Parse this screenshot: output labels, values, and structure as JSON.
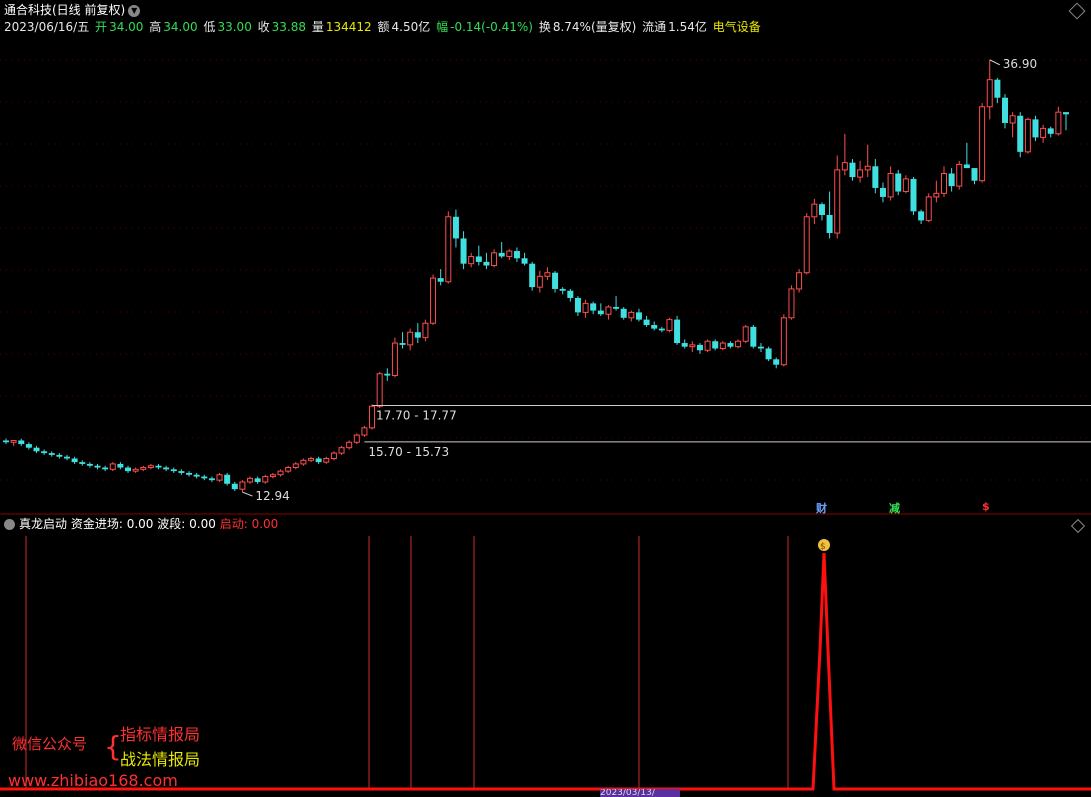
{
  "header": {
    "title": "通合科技(日线 前复权)",
    "date": "2023/06/16/五",
    "open_label": "开",
    "open": "34.00",
    "high_label": "高",
    "high": "34.00",
    "low_label": "低",
    "low": "33.00",
    "close_label": "收",
    "close": "33.88",
    "vol_label": "量",
    "vol": "134412",
    "amount_label": "额",
    "amount": "4.50亿",
    "change_label": "幅",
    "change": "-0.14(-0.41%)",
    "turnover_label": "换",
    "turnover": "8.74%(量复权)",
    "float_label": "流通",
    "float": "1.54亿",
    "sector": "电气设备"
  },
  "annotations": {
    "high_mark": "36.90",
    "low_mark": "12.94",
    "upper_line_label": "17.70 - 17.77",
    "lower_line_label": "15.70 - 15.73"
  },
  "badges": {
    "cai": "财",
    "jian": "减",
    "dollar": "$"
  },
  "indicator": {
    "name": "真龙启动",
    "fund_label": "资金进场:",
    "fund_value": "0.00",
    "wave_label": "波段:",
    "wave_value": "0.00",
    "start_label": "启动:",
    "start_value": "0.00"
  },
  "watermark": {
    "wechat": "微信公众号",
    "item1": "指标情报局",
    "item2": "战法情报局",
    "site": "www.zhibiao168.com"
  },
  "bottom_date": "2023/03/13/",
  "colors": {
    "up": "#ff4d4d",
    "down": "#40e0e0",
    "bg": "#000000",
    "grid": "#5a0000"
  },
  "chart_data": {
    "type": "candlestick",
    "y_range": [
      12.5,
      38
    ],
    "horizontal_lines": [
      17.74,
      15.72
    ],
    "candles": [
      [
        15.8,
        15.9,
        15.6,
        15.7
      ],
      [
        15.7,
        15.8,
        15.5,
        15.8
      ],
      [
        15.8,
        15.9,
        15.5,
        15.6
      ],
      [
        15.6,
        15.7,
        15.3,
        15.4
      ],
      [
        15.4,
        15.5,
        15.1,
        15.2
      ],
      [
        15.2,
        15.3,
        15.0,
        15.1
      ],
      [
        15.1,
        15.2,
        14.9,
        15.0
      ],
      [
        15.0,
        15.1,
        14.8,
        14.9
      ],
      [
        14.9,
        15.0,
        14.7,
        14.8
      ],
      [
        14.8,
        14.9,
        14.5,
        14.6
      ],
      [
        14.6,
        14.7,
        14.4,
        14.5
      ],
      [
        14.5,
        14.6,
        14.3,
        14.4
      ],
      [
        14.4,
        14.5,
        14.2,
        14.3
      ],
      [
        14.3,
        14.4,
        14.1,
        14.2
      ],
      [
        14.2,
        14.6,
        14.1,
        14.5
      ],
      [
        14.5,
        14.6,
        14.2,
        14.3
      ],
      [
        14.3,
        14.4,
        14.0,
        14.1
      ],
      [
        14.1,
        14.3,
        14.0,
        14.2
      ],
      [
        14.2,
        14.4,
        14.1,
        14.3
      ],
      [
        14.3,
        14.5,
        14.2,
        14.4
      ],
      [
        14.4,
        14.5,
        14.2,
        14.3
      ],
      [
        14.3,
        14.4,
        14.1,
        14.2
      ],
      [
        14.2,
        14.3,
        14.0,
        14.1
      ],
      [
        14.1,
        14.2,
        13.9,
        14.0
      ],
      [
        14.0,
        14.1,
        13.8,
        13.9
      ],
      [
        13.9,
        14.0,
        13.7,
        13.8
      ],
      [
        13.8,
        13.9,
        13.6,
        13.7
      ],
      [
        13.7,
        13.8,
        13.5,
        13.6
      ],
      [
        13.6,
        14.0,
        13.5,
        13.9
      ],
      [
        13.9,
        14.0,
        13.3,
        13.4
      ],
      [
        13.4,
        13.5,
        13.0,
        13.1
      ],
      [
        13.1,
        13.6,
        12.94,
        13.5
      ],
      [
        13.5,
        13.8,
        13.4,
        13.7
      ],
      [
        13.7,
        13.8,
        13.4,
        13.5
      ],
      [
        13.5,
        13.9,
        13.4,
        13.8
      ],
      [
        13.8,
        14.0,
        13.7,
        13.9
      ],
      [
        13.9,
        14.2,
        13.8,
        14.1
      ],
      [
        14.1,
        14.4,
        14.0,
        14.3
      ],
      [
        14.3,
        14.6,
        14.2,
        14.5
      ],
      [
        14.5,
        14.8,
        14.4,
        14.7
      ],
      [
        14.7,
        14.9,
        14.6,
        14.8
      ],
      [
        14.8,
        14.9,
        14.5,
        14.6
      ],
      [
        14.6,
        14.9,
        14.5,
        14.8
      ],
      [
        14.8,
        15.2,
        14.7,
        15.1
      ],
      [
        15.1,
        15.5,
        15.0,
        15.4
      ],
      [
        15.4,
        15.8,
        15.3,
        15.7
      ],
      [
        15.7,
        16.2,
        15.6,
        16.1
      ],
      [
        16.1,
        16.6,
        16.0,
        16.5
      ],
      [
        16.5,
        17.8,
        16.4,
        17.7
      ],
      [
        17.7,
        19.6,
        17.6,
        19.5
      ],
      [
        19.5,
        19.8,
        19.1,
        19.4
      ],
      [
        19.4,
        21.5,
        19.3,
        21.2
      ],
      [
        21.2,
        21.8,
        20.9,
        21.1
      ],
      [
        21.1,
        22.0,
        20.8,
        21.8
      ],
      [
        21.8,
        22.3,
        21.2,
        21.5
      ],
      [
        21.5,
        22.5,
        21.3,
        22.3
      ],
      [
        22.3,
        25.0,
        22.2,
        24.8
      ],
      [
        24.8,
        25.3,
        24.4,
        24.6
      ],
      [
        24.6,
        28.5,
        24.5,
        28.2
      ],
      [
        28.2,
        28.6,
        26.5,
        27.0
      ],
      [
        27.0,
        27.4,
        25.3,
        25.6
      ],
      [
        25.6,
        26.2,
        25.4,
        26.0
      ],
      [
        26.0,
        26.6,
        25.5,
        25.7
      ],
      [
        25.7,
        26.2,
        25.3,
        25.5
      ],
      [
        25.5,
        26.4,
        25.4,
        26.2
      ],
      [
        26.2,
        26.8,
        25.9,
        26.0
      ],
      [
        26.0,
        26.4,
        25.8,
        26.3
      ],
      [
        26.3,
        26.5,
        25.7,
        25.9
      ],
      [
        25.9,
        26.2,
        25.5,
        25.6
      ],
      [
        25.6,
        25.7,
        24.1,
        24.3
      ],
      [
        24.3,
        25.2,
        24.0,
        24.9
      ],
      [
        24.9,
        25.4,
        24.7,
        25.1
      ],
      [
        25.1,
        25.2,
        24.0,
        24.2
      ],
      [
        24.2,
        24.3,
        23.9,
        24.1
      ],
      [
        24.1,
        24.2,
        23.5,
        23.7
      ],
      [
        23.7,
        23.8,
        22.7,
        22.9
      ],
      [
        22.9,
        23.6,
        22.6,
        23.4
      ],
      [
        23.4,
        23.5,
        22.8,
        23.0
      ],
      [
        23.0,
        23.4,
        22.7,
        22.8
      ],
      [
        22.8,
        23.3,
        22.5,
        23.2
      ],
      [
        23.2,
        23.8,
        23.0,
        23.1
      ],
      [
        23.1,
        23.2,
        22.5,
        22.6
      ],
      [
        22.6,
        23.0,
        22.4,
        22.9
      ],
      [
        22.9,
        23.1,
        22.4,
        22.5
      ],
      [
        22.5,
        22.7,
        22.1,
        22.2
      ],
      [
        22.2,
        22.4,
        21.9,
        22.0
      ],
      [
        22.0,
        22.1,
        21.8,
        21.9
      ],
      [
        21.9,
        22.6,
        21.8,
        22.5
      ],
      [
        22.5,
        22.7,
        21.1,
        21.2
      ],
      [
        21.2,
        21.4,
        20.9,
        21.0
      ],
      [
        21.0,
        21.3,
        20.7,
        21.1
      ],
      [
        21.1,
        21.2,
        20.6,
        20.8
      ],
      [
        20.8,
        21.4,
        20.7,
        21.3
      ],
      [
        21.3,
        21.4,
        20.8,
        20.9
      ],
      [
        20.9,
        21.3,
        20.8,
        21.2
      ],
      [
        21.2,
        21.3,
        20.9,
        21.0
      ],
      [
        21.0,
        21.4,
        20.9,
        21.3
      ],
      [
        21.3,
        22.2,
        21.2,
        22.1
      ],
      [
        22.1,
        22.2,
        20.9,
        21.0
      ],
      [
        21.0,
        21.2,
        20.7,
        20.9
      ],
      [
        20.9,
        21.0,
        20.2,
        20.3
      ],
      [
        20.3,
        20.4,
        19.8,
        20.0
      ],
      [
        20.0,
        22.8,
        19.9,
        22.6
      ],
      [
        22.6,
        24.4,
        22.5,
        24.2
      ],
      [
        24.2,
        25.3,
        24.0,
        25.1
      ],
      [
        25.1,
        28.4,
        25.0,
        28.2
      ],
      [
        28.2,
        29.2,
        27.8,
        28.9
      ],
      [
        28.9,
        29.0,
        28.0,
        28.3
      ],
      [
        28.3,
        29.6,
        27.0,
        27.3
      ],
      [
        27.3,
        31.6,
        27.0,
        30.8
      ],
      [
        30.8,
        32.8,
        30.5,
        31.2
      ],
      [
        31.2,
        31.4,
        30.2,
        30.4
      ],
      [
        30.4,
        31.3,
        30.1,
        30.8
      ],
      [
        30.8,
        32.2,
        30.4,
        31.0
      ],
      [
        31.0,
        31.4,
        29.5,
        29.8
      ],
      [
        29.8,
        30.1,
        29.0,
        29.3
      ],
      [
        29.3,
        31.0,
        29.1,
        30.6
      ],
      [
        30.6,
        30.8,
        29.4,
        29.6
      ],
      [
        29.6,
        30.5,
        29.5,
        30.3
      ],
      [
        30.3,
        30.4,
        28.3,
        28.5
      ],
      [
        28.5,
        28.6,
        27.8,
        28.0
      ],
      [
        28.0,
        29.5,
        27.9,
        29.3
      ],
      [
        29.3,
        30.2,
        29.0,
        29.5
      ],
      [
        29.5,
        31.0,
        29.3,
        30.6
      ],
      [
        30.6,
        30.9,
        29.6,
        29.9
      ],
      [
        29.9,
        31.3,
        29.7,
        31.1
      ],
      [
        31.1,
        32.3,
        30.9,
        30.9
      ],
      [
        30.9,
        30.9,
        30.0,
        30.2
      ],
      [
        30.2,
        34.5,
        30.1,
        34.3
      ],
      [
        34.3,
        36.9,
        33.6,
        35.8
      ],
      [
        35.8,
        35.9,
        34.5,
        34.8
      ],
      [
        34.8,
        35.0,
        33.1,
        33.4
      ],
      [
        33.4,
        34.0,
        32.6,
        33.8
      ],
      [
        33.8,
        34.0,
        31.5,
        31.8
      ],
      [
        31.8,
        33.7,
        31.7,
        33.6
      ],
      [
        33.6,
        33.8,
        32.4,
        32.6
      ],
      [
        32.6,
        33.3,
        32.3,
        33.1
      ],
      [
        33.1,
        33.2,
        32.6,
        32.8
      ],
      [
        32.8,
        34.3,
        32.7,
        34.0
      ],
      [
        34.0,
        34.0,
        33.0,
        33.88
      ]
    ]
  }
}
